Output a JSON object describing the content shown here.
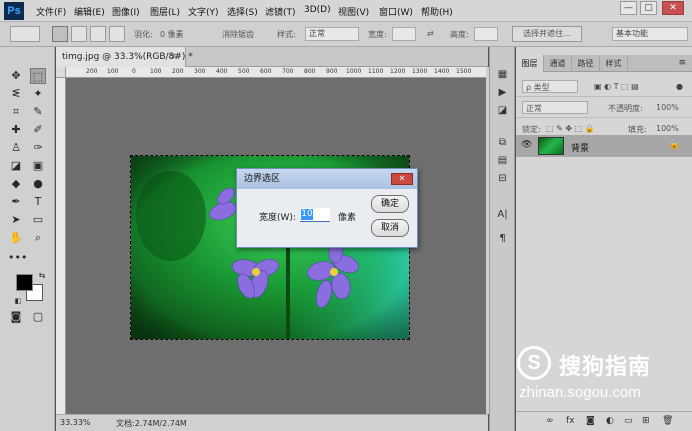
{
  "app": {
    "logo": "Ps"
  },
  "menu": [
    "文件(F)",
    "编辑(E)",
    "图像(I)",
    "图层(L)",
    "文字(Y)",
    "选择(S)",
    "滤镜(T)",
    "3D(D)",
    "视图(V)",
    "窗口(W)",
    "帮助(H)"
  ],
  "window_controls": {
    "minimize": "—",
    "restore": "▢",
    "close": "✕"
  },
  "options": {
    "feather_label": "羽化:",
    "feather_value": "0 像素",
    "antialias_label": "消除锯齿",
    "style_label": "样式:",
    "style_value": "正常",
    "width_label": "宽度:",
    "height_label": "高度:",
    "select_mask_button": "选择并遮住...",
    "workspace_value": "基本功能"
  },
  "document": {
    "tab_title": "timg.jpg @ 33.3%(RGB/8#) *",
    "zoom": "33.33%",
    "doc_info": "文档:2.74M/2.74M",
    "ruler_ticks": [
      "200",
      "100",
      "0",
      "100",
      "200",
      "300",
      "400",
      "500",
      "600",
      "700",
      "800",
      "900",
      "1000",
      "1100",
      "1200",
      "1300",
      "1400",
      "1500"
    ]
  },
  "dialog": {
    "title": "边界选区",
    "width_label": "宽度(W):",
    "width_value": "10",
    "unit": "像素",
    "ok_button": "确定",
    "cancel_button": "取消",
    "close_glyph": "✕"
  },
  "panel": {
    "tabs": [
      "图层",
      "通道",
      "路径",
      "样式"
    ],
    "filter_label": "ρ 类型",
    "blend_mode": "正常",
    "opacity_label": "不透明度:",
    "opacity_value": "100%",
    "lock_label": "锁定:",
    "fill_label": "填充:",
    "fill_value": "100%",
    "layer_name": "背景"
  },
  "watermark": {
    "logo_letter": "S",
    "text": "搜狗指南",
    "url": "zhinan.sogou.com"
  },
  "colors": {
    "foreground": "#000000",
    "background": "#ffffff",
    "selected_layer": "#a7a7a7",
    "dialog_title": "#b9cde8"
  }
}
